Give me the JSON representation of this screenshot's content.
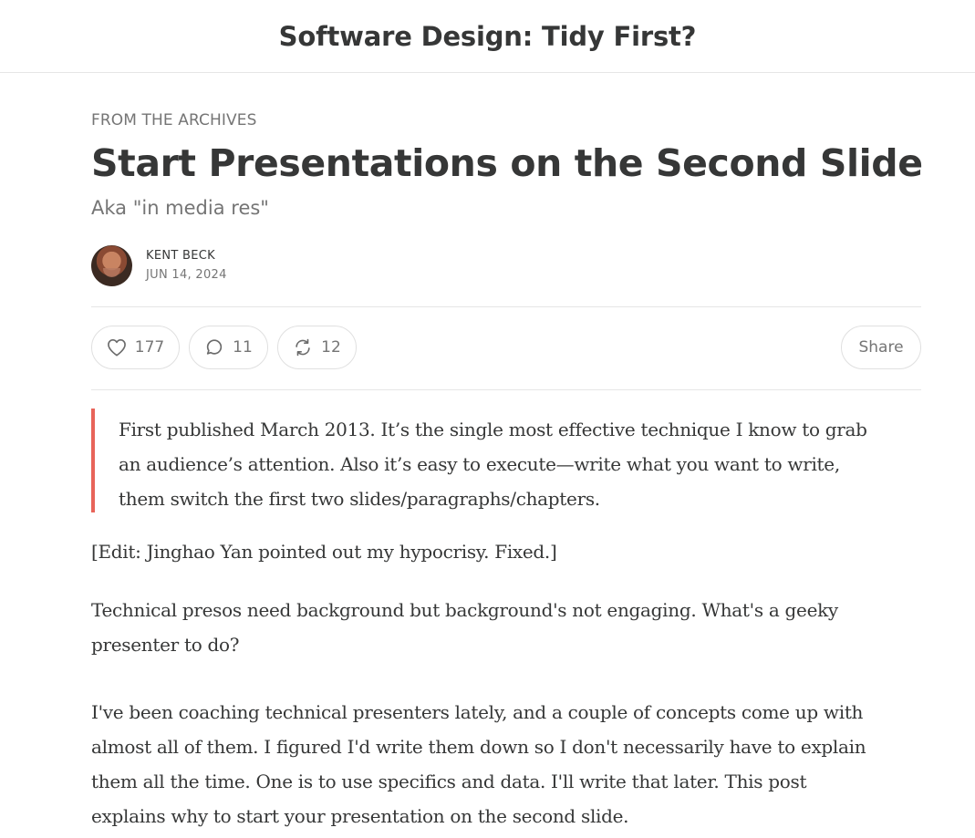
{
  "header": {
    "publication": "Software Design: Tidy First?"
  },
  "post": {
    "kicker": "FROM THE ARCHIVES",
    "title": "Start Presentations on the Second Slide",
    "subtitle": "Aka \"in media res\"",
    "author": "KENT BECK",
    "date": "JUN 14, 2024"
  },
  "actions": {
    "likes": "177",
    "comments": "11",
    "restacks": "12",
    "share_label": "Share",
    "icons": {
      "like": "heart-icon",
      "comment": "comment-bubble-icon",
      "restack": "restack-arrows-icon"
    }
  },
  "content": {
    "quote_lines": [
      "First published March 2013. It’s the single most effective technique I know to grab",
      "an audience’s attention. Also it’s easy to execute—write what you want to write,",
      "them switch the first two slides/paragraphs/chapters."
    ],
    "para1": "[Edit: Jinghao Yan pointed out my hypocrisy. Fixed.]",
    "para2_lines": [
      "Technical presos need background but background's not engaging. What's a geeky",
      "presenter to do?"
    ],
    "para3_lines": [
      "I've been coaching technical presenters lately, and a couple of concepts come up with",
      "almost all of them. I figured I'd write them down so I don't necessarily have to explain",
      "them all the time. One is to use specifics and data. I'll write that later. This post",
      "explains why to start your presentation on the second slide."
    ]
  },
  "colors": {
    "text": "#363737",
    "muted": "#757575",
    "quote_bar": "#e8645a",
    "divider": "#e6e6e6"
  }
}
